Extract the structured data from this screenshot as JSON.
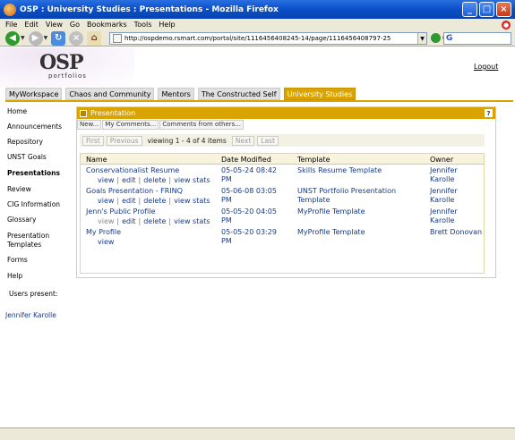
{
  "window": {
    "title": "OSP : University Studies : Presentations - Mozilla Firefox",
    "controls": [
      "_",
      "□",
      "×"
    ]
  },
  "menu": [
    "File",
    "Edit",
    "View",
    "Go",
    "Bookmarks",
    "Tools",
    "Help"
  ],
  "toolbar": {
    "url": "http://ospdemo.rsmart.com/portal/site/1116456408245-14/page/1116456408797-25",
    "go_label": "Go",
    "search_logo": "G"
  },
  "header": {
    "logo_text": "OSP",
    "logo_sub": "portfolios",
    "logout": "Logout"
  },
  "site_tabs": [
    {
      "label": "MyWorkspace",
      "active": false
    },
    {
      "label": "Chaos and Community",
      "active": false
    },
    {
      "label": "Mentors",
      "active": false
    },
    {
      "label": "The Constructed Self",
      "active": false
    },
    {
      "label": "University Studies",
      "active": true
    }
  ],
  "left_nav": {
    "items": [
      "Home",
      "Announcements",
      "Repository",
      "UNST Goals",
      "Presentations",
      "Review",
      "CIG Information",
      "Glossary",
      "Presentation Templates",
      "Forms",
      "Help"
    ],
    "active": "Presentations",
    "users_present_label": "Users present:",
    "users": [
      "Jennifer Karolle"
    ]
  },
  "portlet": {
    "title": "Presentation",
    "help": "?",
    "actions": [
      "New...",
      "My Comments...",
      "Comments from others..."
    ],
    "pager": {
      "first": "First",
      "previous": "Previous",
      "viewing": "viewing 1 - 4 of 4 items",
      "next": "Next",
      "last": "Last"
    },
    "columns": [
      "Name",
      "Date Modified",
      "Template",
      "Owner"
    ],
    "rows": [
      {
        "name": "Conservationalist Resume",
        "date": "05-05-24 08:42 PM",
        "template": "Skills Resume Template",
        "owner": "Jennifer Karolle",
        "actions": [
          "view",
          "edit",
          "delete",
          "view stats"
        ]
      },
      {
        "name": "Goals Presentation - FRINQ",
        "date": "05-06-08 03:05 PM",
        "template": "UNST Portfolio Presentation Template",
        "owner": "Jennifer Karolle",
        "actions": [
          "view",
          "edit",
          "delete",
          "view stats"
        ]
      },
      {
        "name": "Jenn's Public Profile",
        "date": "05-05-20 04:05 PM",
        "template": "MyProfile Template",
        "owner": "Jennifer Karolle",
        "actions": [
          "view",
          "edit",
          "delete",
          "view stats"
        ]
      },
      {
        "name": "My Profile",
        "date": "05-05-20 03:29 PM",
        "template": "MyProfile Template",
        "owner": "Brett Donovan",
        "actions": [
          "view"
        ]
      }
    ]
  },
  "status": {
    "text": ""
  }
}
